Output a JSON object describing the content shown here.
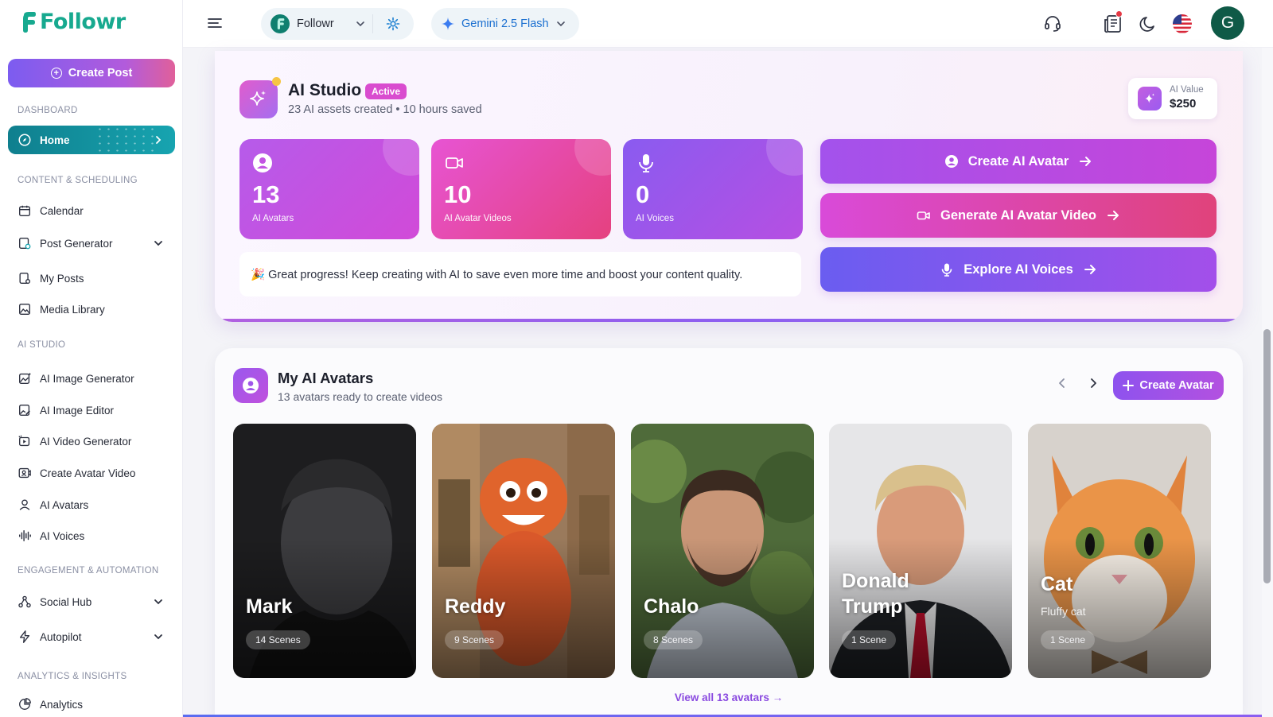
{
  "app": {
    "logo_text": "Followr",
    "brand_color": "#17a98f"
  },
  "sidebar": {
    "create_post_label": "Create Post",
    "sections": {
      "dashboard": "DASHBOARD",
      "content": "CONTENT & SCHEDULING",
      "ai_studio": "AI STUDIO",
      "engagement": "ENGAGEMENT & AUTOMATION",
      "analytics": "ANALYTICS & INSIGHTS"
    },
    "items": {
      "home": "Home",
      "calendar": "Calendar",
      "post_generator": "Post Generator",
      "my_posts": "My Posts",
      "media_library": "Media Library",
      "ai_image_generator": "AI Image Generator",
      "ai_image_editor": "AI Image Editor",
      "ai_video_generator": "AI Video Generator",
      "create_avatar_video": "Create Avatar Video",
      "ai_avatars": "AI Avatars",
      "ai_voices": "AI Voices",
      "social_hub": "Social Hub",
      "autopilot": "Autopilot",
      "analytics": "Analytics"
    }
  },
  "topbar": {
    "workspace_label": "Followr",
    "model_label": "Gemini 2.5 Flash",
    "user_initial": "G",
    "icons": [
      "support-headset-icon",
      "news-icon",
      "moon-icon",
      "us-flag-icon"
    ]
  },
  "studio": {
    "title": "AI Studio",
    "badge": "Active",
    "subtitle": "23 AI assets created • 10 hours saved",
    "value_label": "AI Value",
    "value_amount": "$250",
    "stats": [
      {
        "value": "13",
        "label": "AI Avatars"
      },
      {
        "value": "10",
        "label": "AI Avatar Videos"
      },
      {
        "value": "0",
        "label": "AI Voices"
      }
    ],
    "progress_note": "🎉 Great progress! Keep creating with AI to save even more time and boost your content quality.",
    "actions": {
      "create_avatar": "Create AI Avatar",
      "generate_video": "Generate AI Avatar Video",
      "explore_voices": "Explore AI Voices"
    }
  },
  "avatars": {
    "title": "My AI Avatars",
    "subtitle": "13 avatars ready to create videos",
    "create_button": "Create Avatar",
    "cards": [
      {
        "name": "Mark",
        "desc": "",
        "scenes": "14 Scenes"
      },
      {
        "name": "Reddy",
        "desc": "",
        "scenes": "9 Scenes"
      },
      {
        "name": "Chalo",
        "desc": "",
        "scenes": "8 Scenes"
      },
      {
        "name_line1": "Donald",
        "name_line2": "Trump",
        "desc": "",
        "scenes": "1 Scene"
      },
      {
        "name": "Cat",
        "desc": "Fluffy cat",
        "scenes": "1 Scene"
      }
    ],
    "view_all": "View all 13 avatars →"
  }
}
